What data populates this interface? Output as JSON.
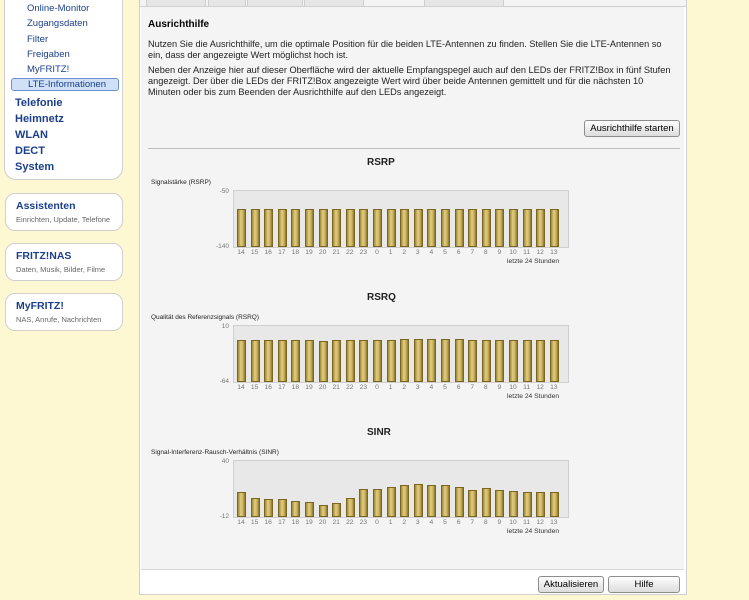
{
  "sidebar": {
    "sub_items": [
      "Online-Monitor",
      "Zugangsdaten",
      "Filter",
      "Freigaben",
      "MyFRITZ!",
      "LTE-Informationen"
    ],
    "main_items": [
      "Telefonie",
      "Heimnetz",
      "WLAN",
      "DECT",
      "System"
    ],
    "boxes": [
      {
        "title": "Assistenten",
        "subtitle": "Einrichten, Update, Telefone"
      },
      {
        "title": "FRITZ!NAS",
        "subtitle": "Daten, Musik, Bilder, Filme"
      },
      {
        "title": "MyFRITZ!",
        "subtitle": "NAS, Anrufe, Nachrichten"
      }
    ]
  },
  "content": {
    "heading": "Ausrichthilfe",
    "para1": "Nutzen Sie die Ausrichthilfe, um die optimale Position für die beiden LTE-Antennen zu finden. Stellen Sie die LTE-Antennen so ein, dass der angezeigte Wert möglichst hoch ist.",
    "para2": "Neben der Anzeige hier auf dieser Oberfläche wird der aktuelle Empfangspegel auch auf den LEDs der FRITZ!Box in fünf Stufen angezeigt. Der über die LEDs der FRITZ!Box angezeigte Wert wird über beide Antennen gemittelt und für die nächsten 10 Minuten oder bis zum Beenden der Ausrichthilfe auf den LEDs angezeigt.",
    "start_button": "Ausrichthilfe starten",
    "refresh_button": "Aktualisieren",
    "help_button": "Hilfe"
  },
  "chart_data": [
    {
      "type": "bar",
      "title": "RSRP",
      "ylabel": "Signalstärke (RSRP)",
      "ylim": [
        -140,
        -50
      ],
      "yticks": [
        "-50",
        "-140"
      ],
      "categories": [
        "14",
        "15",
        "16",
        "17",
        "18",
        "19",
        "20",
        "21",
        "22",
        "23",
        "0",
        "1",
        "2",
        "3",
        "4",
        "5",
        "6",
        "7",
        "8",
        "9",
        "10",
        "11",
        "12",
        "13"
      ],
      "values": [
        -76,
        -76,
        -76,
        -76,
        -76,
        -76,
        -76,
        -76,
        -76,
        -76,
        -76,
        -76,
        -76,
        -76,
        -76,
        -76,
        -76,
        -76,
        -76,
        -76,
        -76,
        -76,
        -76,
        -76
      ],
      "xnote": "letzte 24 Stunden"
    },
    {
      "type": "bar",
      "title": "RSRQ",
      "ylabel": "Qualität des Referenzsignals (RSRQ)",
      "ylim": [
        -64,
        10
      ],
      "yticks": [
        "10",
        "-64"
      ],
      "categories": [
        "14",
        "15",
        "16",
        "17",
        "18",
        "19",
        "20",
        "21",
        "22",
        "23",
        "0",
        "1",
        "2",
        "3",
        "4",
        "5",
        "6",
        "7",
        "8",
        "9",
        "10",
        "11",
        "12",
        "13"
      ],
      "values": [
        -6,
        -7,
        -7,
        -7,
        -7,
        -7,
        -8,
        -7,
        -6,
        -6,
        -6,
        -6,
        -5,
        -5,
        -5,
        -5,
        -5,
        -6,
        -6,
        -6,
        -6,
        -6,
        -6,
        -6
      ],
      "xnote": "letzte 24 Stunden"
    },
    {
      "type": "bar",
      "title": "SINR",
      "ylabel": "Signal-Interferenz-Rausch-Verhältnis (SINR)",
      "ylim": [
        -12,
        40
      ],
      "yticks": [
        "40",
        "-12"
      ],
      "categories": [
        "14",
        "15",
        "16",
        "17",
        "18",
        "19",
        "20",
        "21",
        "22",
        "23",
        "0",
        "1",
        "2",
        "3",
        "4",
        "5",
        "6",
        "7",
        "8",
        "9",
        "10",
        "11",
        "12",
        "13"
      ],
      "values": [
        12,
        6,
        5,
        5,
        3,
        2,
        0,
        1,
        6,
        15,
        15,
        17,
        19,
        20,
        19,
        19,
        17,
        14,
        16,
        14,
        13,
        12,
        12,
        12
      ],
      "xnote": "letzte 24 Stunden"
    }
  ]
}
